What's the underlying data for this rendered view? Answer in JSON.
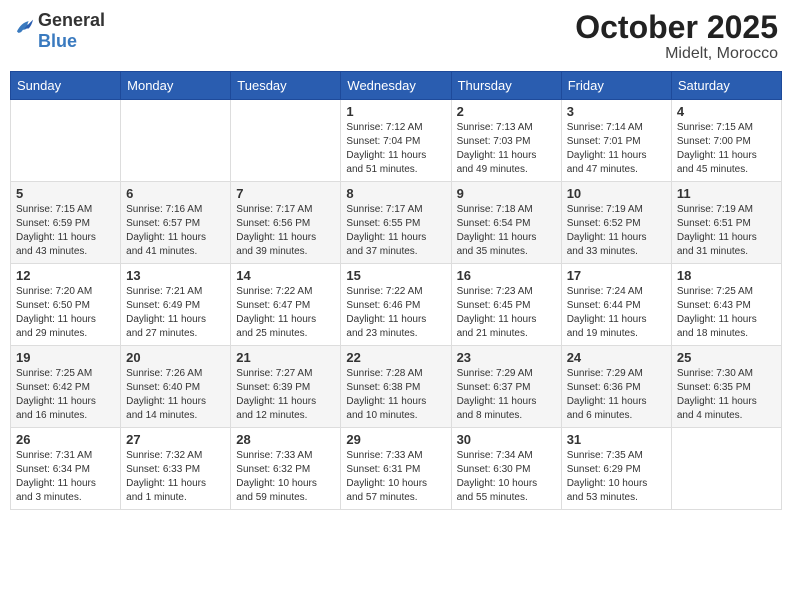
{
  "header": {
    "logo": {
      "general": "General",
      "blue": "Blue"
    },
    "month": "October 2025",
    "location": "Midelt, Morocco"
  },
  "weekdays": [
    "Sunday",
    "Monday",
    "Tuesday",
    "Wednesday",
    "Thursday",
    "Friday",
    "Saturday"
  ],
  "weeks": [
    [
      {
        "day": "",
        "info": ""
      },
      {
        "day": "",
        "info": ""
      },
      {
        "day": "",
        "info": ""
      },
      {
        "day": "1",
        "info": "Sunrise: 7:12 AM\nSunset: 7:04 PM\nDaylight: 11 hours\nand 51 minutes."
      },
      {
        "day": "2",
        "info": "Sunrise: 7:13 AM\nSunset: 7:03 PM\nDaylight: 11 hours\nand 49 minutes."
      },
      {
        "day": "3",
        "info": "Sunrise: 7:14 AM\nSunset: 7:01 PM\nDaylight: 11 hours\nand 47 minutes."
      },
      {
        "day": "4",
        "info": "Sunrise: 7:15 AM\nSunset: 7:00 PM\nDaylight: 11 hours\nand 45 minutes."
      }
    ],
    [
      {
        "day": "5",
        "info": "Sunrise: 7:15 AM\nSunset: 6:59 PM\nDaylight: 11 hours\nand 43 minutes."
      },
      {
        "day": "6",
        "info": "Sunrise: 7:16 AM\nSunset: 6:57 PM\nDaylight: 11 hours\nand 41 minutes."
      },
      {
        "day": "7",
        "info": "Sunrise: 7:17 AM\nSunset: 6:56 PM\nDaylight: 11 hours\nand 39 minutes."
      },
      {
        "day": "8",
        "info": "Sunrise: 7:17 AM\nSunset: 6:55 PM\nDaylight: 11 hours\nand 37 minutes."
      },
      {
        "day": "9",
        "info": "Sunrise: 7:18 AM\nSunset: 6:54 PM\nDaylight: 11 hours\nand 35 minutes."
      },
      {
        "day": "10",
        "info": "Sunrise: 7:19 AM\nSunset: 6:52 PM\nDaylight: 11 hours\nand 33 minutes."
      },
      {
        "day": "11",
        "info": "Sunrise: 7:19 AM\nSunset: 6:51 PM\nDaylight: 11 hours\nand 31 minutes."
      }
    ],
    [
      {
        "day": "12",
        "info": "Sunrise: 7:20 AM\nSunset: 6:50 PM\nDaylight: 11 hours\nand 29 minutes."
      },
      {
        "day": "13",
        "info": "Sunrise: 7:21 AM\nSunset: 6:49 PM\nDaylight: 11 hours\nand 27 minutes."
      },
      {
        "day": "14",
        "info": "Sunrise: 7:22 AM\nSunset: 6:47 PM\nDaylight: 11 hours\nand 25 minutes."
      },
      {
        "day": "15",
        "info": "Sunrise: 7:22 AM\nSunset: 6:46 PM\nDaylight: 11 hours\nand 23 minutes."
      },
      {
        "day": "16",
        "info": "Sunrise: 7:23 AM\nSunset: 6:45 PM\nDaylight: 11 hours\nand 21 minutes."
      },
      {
        "day": "17",
        "info": "Sunrise: 7:24 AM\nSunset: 6:44 PM\nDaylight: 11 hours\nand 19 minutes."
      },
      {
        "day": "18",
        "info": "Sunrise: 7:25 AM\nSunset: 6:43 PM\nDaylight: 11 hours\nand 18 minutes."
      }
    ],
    [
      {
        "day": "19",
        "info": "Sunrise: 7:25 AM\nSunset: 6:42 PM\nDaylight: 11 hours\nand 16 minutes."
      },
      {
        "day": "20",
        "info": "Sunrise: 7:26 AM\nSunset: 6:40 PM\nDaylight: 11 hours\nand 14 minutes."
      },
      {
        "day": "21",
        "info": "Sunrise: 7:27 AM\nSunset: 6:39 PM\nDaylight: 11 hours\nand 12 minutes."
      },
      {
        "day": "22",
        "info": "Sunrise: 7:28 AM\nSunset: 6:38 PM\nDaylight: 11 hours\nand 10 minutes."
      },
      {
        "day": "23",
        "info": "Sunrise: 7:29 AM\nSunset: 6:37 PM\nDaylight: 11 hours\nand 8 minutes."
      },
      {
        "day": "24",
        "info": "Sunrise: 7:29 AM\nSunset: 6:36 PM\nDaylight: 11 hours\nand 6 minutes."
      },
      {
        "day": "25",
        "info": "Sunrise: 7:30 AM\nSunset: 6:35 PM\nDaylight: 11 hours\nand 4 minutes."
      }
    ],
    [
      {
        "day": "26",
        "info": "Sunrise: 7:31 AM\nSunset: 6:34 PM\nDaylight: 11 hours\nand 3 minutes."
      },
      {
        "day": "27",
        "info": "Sunrise: 7:32 AM\nSunset: 6:33 PM\nDaylight: 11 hours\nand 1 minute."
      },
      {
        "day": "28",
        "info": "Sunrise: 7:33 AM\nSunset: 6:32 PM\nDaylight: 10 hours\nand 59 minutes."
      },
      {
        "day": "29",
        "info": "Sunrise: 7:33 AM\nSunset: 6:31 PM\nDaylight: 10 hours\nand 57 minutes."
      },
      {
        "day": "30",
        "info": "Sunrise: 7:34 AM\nSunset: 6:30 PM\nDaylight: 10 hours\nand 55 minutes."
      },
      {
        "day": "31",
        "info": "Sunrise: 7:35 AM\nSunset: 6:29 PM\nDaylight: 10 hours\nand 53 minutes."
      },
      {
        "day": "",
        "info": ""
      }
    ]
  ]
}
